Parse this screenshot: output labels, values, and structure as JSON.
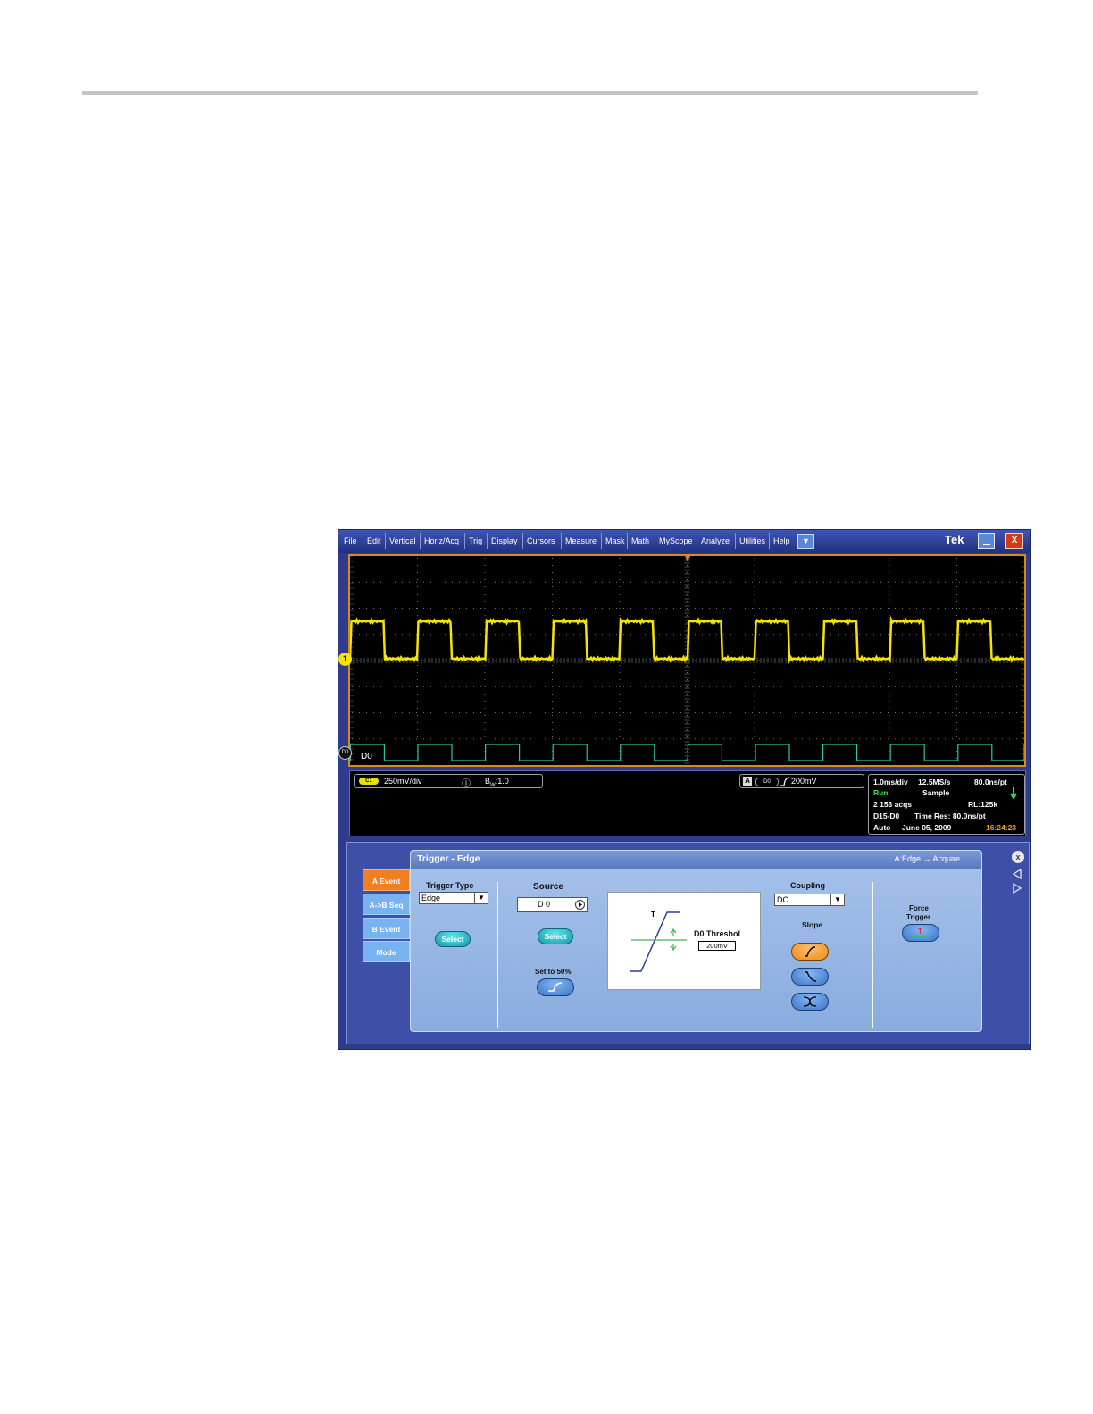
{
  "menu": {
    "items": [
      "File",
      "Edit",
      "Vertical",
      "Horiz/Acq",
      "Trig",
      "Display",
      "Cursors",
      "Measure",
      "Mask",
      "Math",
      "MyScope",
      "Analyze",
      "Utilities",
      "Help"
    ],
    "brand": "Tek",
    "close_glyph": "X",
    "dropdown_glyph": "▼"
  },
  "graticule": {
    "ch1_marker": "1",
    "d0_marker": "D0",
    "d0_label": "D0",
    "colors": {
      "ch1": "#f7e300",
      "d0": "#2ec4a0",
      "d0_low": "#3060e0",
      "border": "#d88a1b"
    }
  },
  "readout": {
    "ch_badge": "C1",
    "ch_scale": "250mV/div",
    "info_glyph": "ⓘ",
    "bw": "B",
    "bw_sub": "W",
    "bw_value": ":1.0",
    "trig_letter": "A",
    "trig_source": "D0",
    "trig_level": "200mV",
    "status": {
      "timebase": "1.0ms/div",
      "sample_rate": "12.5MS/s",
      "pt_res": "80.0ns/pt",
      "run": "Run",
      "mode": "Sample",
      "acqs": "2 153 acqs",
      "record": "RL:125k",
      "digital": "D15-D0",
      "time_res": "Time Res: 80.0ns/pt",
      "trigger_mode": "Auto",
      "date": "June 05, 2009",
      "time": "16:24:23"
    }
  },
  "side_tabs": [
    "A Event",
    "A->B Seq",
    "B Event",
    "Mode"
  ],
  "panel": {
    "title": "Trigger - Edge",
    "breadcrumb": "A:Edge → Acquire",
    "trigger_type_label": "Trigger Type",
    "trigger_type_value": "Edge",
    "select_label": "Select",
    "source_label": "Source",
    "source_value": "D 0",
    "source_select_label": "Select",
    "set50_label": "Set to 50%",
    "diagram_t": "T",
    "threshold_label": "D0 Threshol",
    "threshold_value": "200mV",
    "coupling_label": "Coupling",
    "coupling_value": "DC",
    "slope_label": "Slope",
    "force_label": "Force",
    "trigger_label": "Trigger",
    "force_glyph": "T",
    "close_glyph": "x"
  }
}
